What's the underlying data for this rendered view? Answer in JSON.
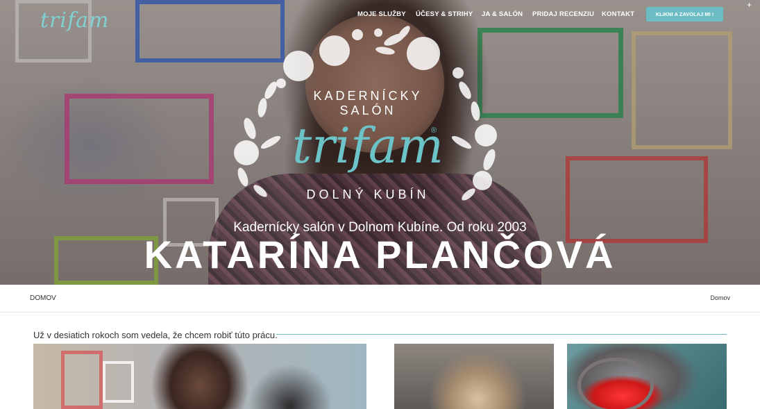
{
  "header": {
    "logo_text": "trifam",
    "nav": [
      {
        "label": "MOJE SLUŽBY"
      },
      {
        "label": "ÚČESY & STRIHY"
      },
      {
        "label": "JA & SALÓN"
      },
      {
        "label": "PRIDAJ RECENZIU"
      },
      {
        "label": "KONTAKT"
      }
    ],
    "cta_label": "KLIKNI A ZAVOLAJ MI !",
    "colors": {
      "accent": "#6cbcc4",
      "brand": "#6cc3c8"
    }
  },
  "hero": {
    "emblem": {
      "line1": "KADERNÍCKY",
      "line2": "SALÓN",
      "brand": "trifam",
      "registered": "®",
      "line3": "DOLNÝ KUBÍN"
    },
    "subtitle": "Kadernícky salón v Dolnom Kubíne. Od roku 2003",
    "title": "KATARÍNA PLANČOVÁ"
  },
  "breadcrumb": {
    "page_title": "DOMOV",
    "link": "Domov"
  },
  "content": {
    "heading": "Už v desiatich rokoch som vedela, že chcem robiť túto prácu."
  }
}
